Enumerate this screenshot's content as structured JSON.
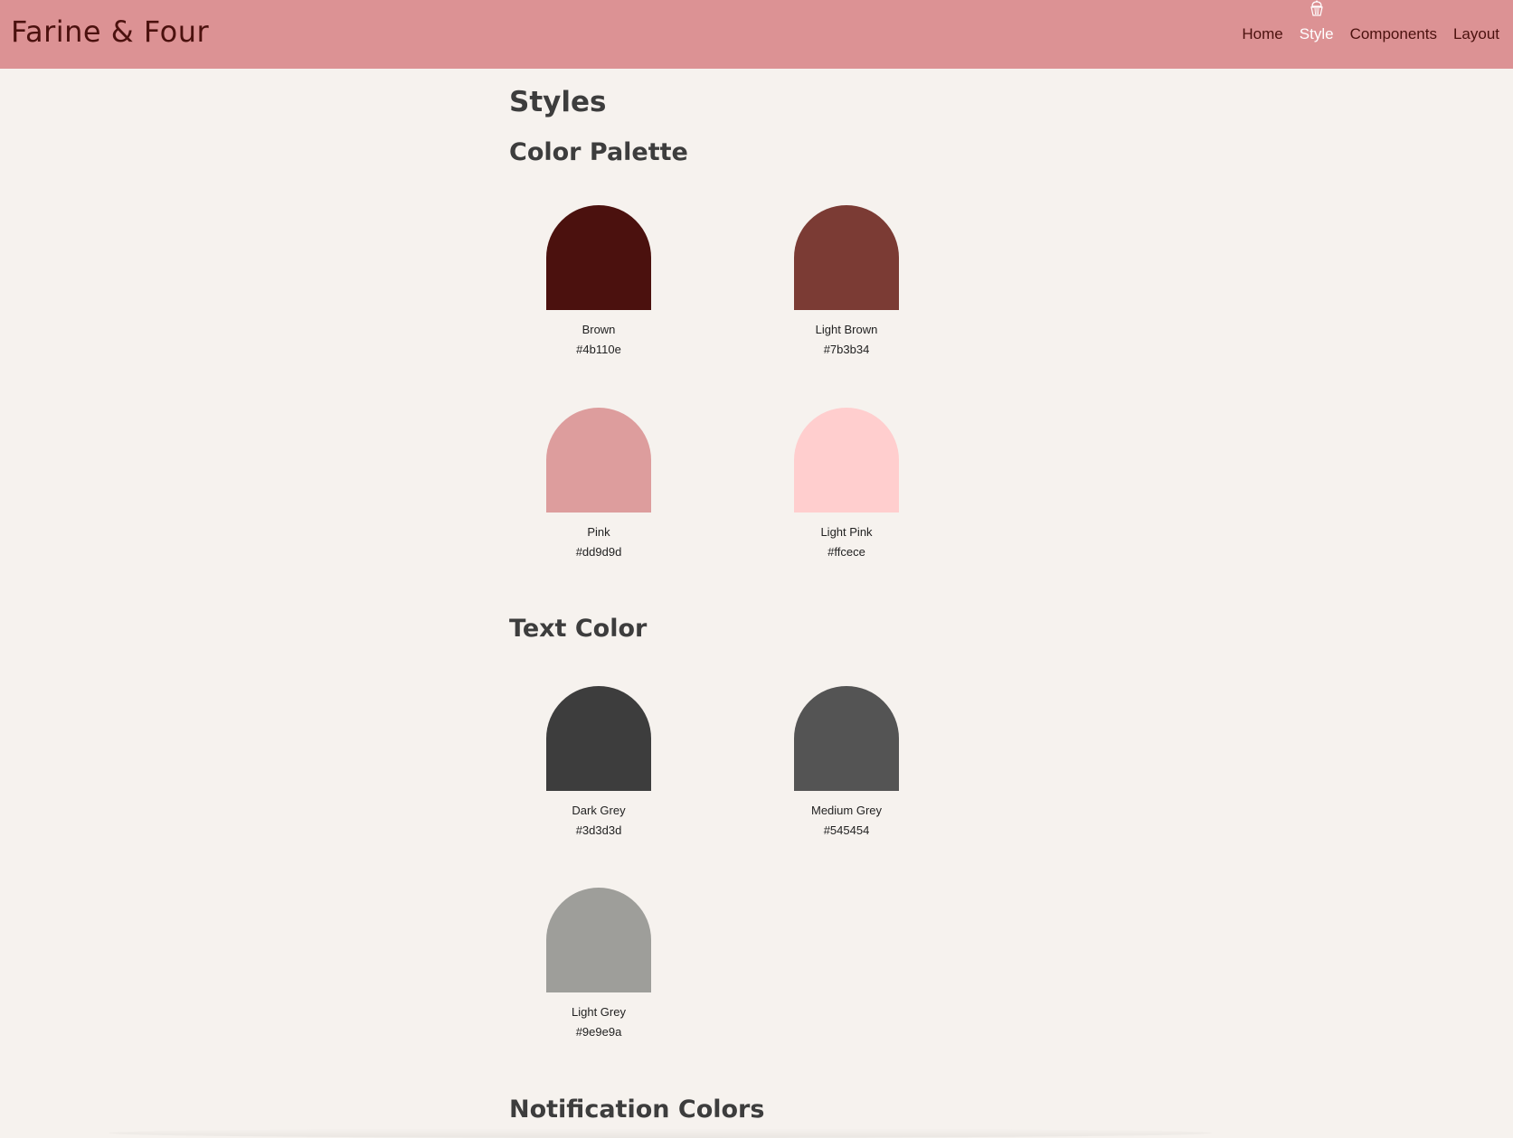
{
  "header": {
    "brand": "Farine & Four",
    "nav": [
      {
        "label": "Home"
      },
      {
        "label": "Style",
        "active": true
      },
      {
        "label": "Components"
      },
      {
        "label": "Layout"
      }
    ],
    "background": "#dc9294",
    "brand_color": "#4b110e",
    "active_icon": "cupcake-icon"
  },
  "main": {
    "title": "Styles",
    "sections": {
      "palette": {
        "title": "Color Palette",
        "swatches": [
          {
            "name": "Brown",
            "hex": "#4b110e",
            "color": "#4b110e"
          },
          {
            "name": "Light Brown",
            "hex": "#7b3b34",
            "color": "#7b3b34"
          },
          {
            "name": "Pink",
            "hex": "#dd9d9d",
            "color": "#dd9d9d"
          },
          {
            "name": "Light Pink",
            "hex": "#ffcece",
            "color": "#ffcece"
          }
        ]
      },
      "text": {
        "title": "Text Color",
        "swatches": [
          {
            "name": "Dark Grey",
            "hex": "#3d3d3d",
            "color": "#3d3d3d"
          },
          {
            "name": "Medium Grey",
            "hex": "#545454",
            "color": "#545454"
          },
          {
            "name": "Light Grey",
            "hex": "#9e9e9a",
            "color": "#9e9e9a"
          }
        ]
      },
      "notification": {
        "title": "Notification Colors"
      }
    }
  }
}
